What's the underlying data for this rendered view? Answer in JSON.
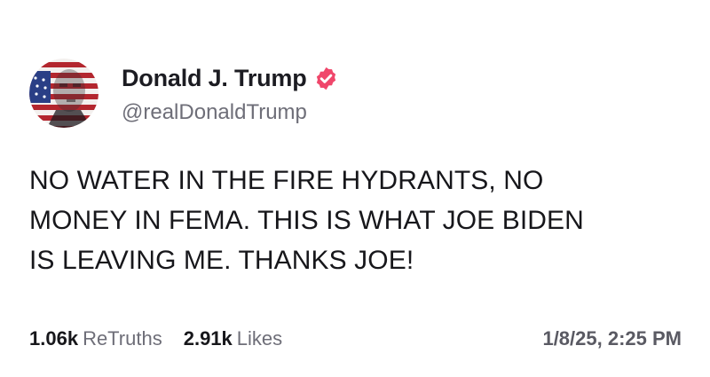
{
  "post": {
    "author": {
      "display_name": "Donald J. Trump",
      "handle": "@realDonaldTrump",
      "verified": true,
      "verified_icon": "verified-badge-icon",
      "avatar_icon": "profile-avatar-image"
    },
    "body_lines": [
      "NO WATER IN THE FIRE HYDRANTS, NO",
      "MONEY IN FEMA. THIS IS WHAT JOE BIDEN",
      "IS LEAVING ME. THANKS JOE!"
    ],
    "stats": {
      "retruths_count": "1.06k",
      "retruths_label": "ReTruths",
      "likes_count": "2.91k",
      "likes_label": "Likes"
    },
    "timestamp": "1/8/25, 2:25 PM"
  },
  "colors": {
    "background": "#ffffff",
    "verified_badge": "#f0476b",
    "text_primary": "#17171b",
    "text_secondary": "#6e6e78"
  }
}
